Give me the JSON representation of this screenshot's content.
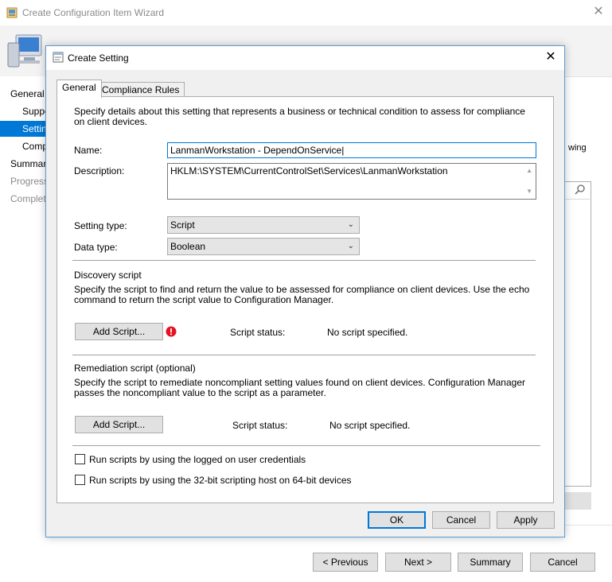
{
  "wizard": {
    "title": "Create Configuration Item Wizard",
    "close_glyph": "✕",
    "nav": {
      "general": "General",
      "supported": "Suppo",
      "settings": "Settin",
      "compliance": "Comp",
      "summary": "Summar",
      "progress": "Progress",
      "completion": "Complet"
    },
    "right_text": "wing",
    "buttons": {
      "previous": "< Previous",
      "next": "Next >",
      "summary": "Summary",
      "cancel": "Cancel"
    }
  },
  "dialog": {
    "title": "Create Setting",
    "close_glyph": "✕",
    "tabs": [
      "General",
      "Compliance Rules"
    ],
    "intro": "Specify details about this setting that represents a business or technical condition to assess for compliance on client devices.",
    "name_label": "Name:",
    "name_value": "LanmanWorkstation - DependOnService",
    "description_label": "Description:",
    "description_value": "HKLM:\\SYSTEM\\CurrentControlSet\\Services\\LanmanWorkstation",
    "setting_type_label": "Setting type:",
    "setting_type_value": "Script",
    "data_type_label": "Data type:",
    "data_type_value": "Boolean",
    "discovery": {
      "heading": "Discovery script",
      "text": "Specify the script to find and return the value to be assessed for compliance on client devices. Use the echo command to return the script value to Configuration Manager.",
      "add_button": "Add Script...",
      "status_label": "Script status:",
      "status_value": "No script specified."
    },
    "remediation": {
      "heading": "Remediation script (optional)",
      "text": "Specify the script to remediate noncompliant setting values found on client devices. Configuration Manager passes the noncompliant value to the script as a parameter.",
      "add_button": "Add Script...",
      "status_label": "Script status:",
      "status_value": "No script specified."
    },
    "checkbox_logged_on": "Run scripts by using the logged on user credentials",
    "checkbox_32bit": "Run scripts by using the 32-bit scripting host on 64-bit devices",
    "buttons": {
      "ok": "OK",
      "cancel": "Cancel",
      "apply": "Apply"
    }
  },
  "colors": {
    "accent": "#0078d7",
    "error": "#e81123",
    "dialog_bg": "#f0f0f0"
  },
  "icons": [
    "wizard-app-icon",
    "computer-icon",
    "search-icon",
    "dialog-app-icon",
    "close-icon",
    "error-icon",
    "chevron-down-icon"
  ]
}
